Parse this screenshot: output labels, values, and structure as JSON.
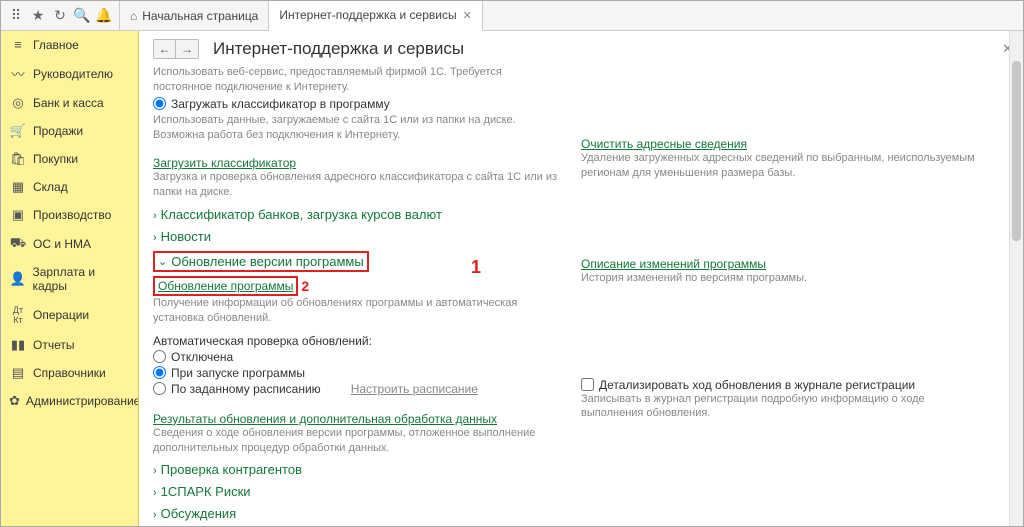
{
  "topbar": {
    "home_tab": "Начальная страница",
    "active_tab": "Интернет-поддержка и сервисы"
  },
  "sidebar": {
    "items": [
      {
        "label": "Главное",
        "icon": "≡"
      },
      {
        "label": "Руководителю",
        "icon": "📈"
      },
      {
        "label": "Банк и касса",
        "icon": "💰"
      },
      {
        "label": "Продажи",
        "icon": "🛒"
      },
      {
        "label": "Покупки",
        "icon": "🛍"
      },
      {
        "label": "Склад",
        "icon": "📦"
      },
      {
        "label": "Производство",
        "icon": "🏭"
      },
      {
        "label": "ОС и НМА",
        "icon": "🚚"
      },
      {
        "label": "Зарплата и кадры",
        "icon": "👤"
      },
      {
        "label": "Операции",
        "icon": "Дт"
      },
      {
        "label": "Отчеты",
        "icon": "📊"
      },
      {
        "label": "Справочники",
        "icon": "📓"
      },
      {
        "label": "Администрирование",
        "icon": "⚙"
      }
    ]
  },
  "page": {
    "title": "Интернет-поддержка и сервисы",
    "intro1": "Использовать веб-сервис, предоставляемый фирмой 1С. Требуется постоянное подключение к Интернету.",
    "radio_load": "Загружать классификатор в программу",
    "intro2": "Использовать данные, загружаемые с сайта 1С или из папки на диске. Возможна работа без подключения к Интернету.",
    "load_classifier": "Загрузить классификатор",
    "load_classifier_desc": "Загрузка и проверка обновления адресного классификатора с сайта 1С или из папки на диске.",
    "clear_addr": "Очистить адресные сведения",
    "clear_addr_desc": "Удаление загруженных адресных сведений по выбранным, неиспользуемым регионам для уменьшения размера базы.",
    "exp_banks": "Классификатор банков, загрузка курсов валют",
    "exp_news": "Новости",
    "section_update": "Обновление версии программы",
    "update_program": "Обновление программы",
    "update_program_desc": "Получение информации об обновлениях программы и автоматическая установка обновлений.",
    "changes_desc_link": "Описание изменений программы",
    "changes_desc_text": "История изменений по версиям программы.",
    "auto_check_label": "Автоматическая проверка обновлений:",
    "opt_off": "Отключена",
    "opt_on_start": "При запуске программы",
    "opt_schedule": "По заданному расписанию",
    "configure_schedule": "Настроить расписание",
    "results_link": "Результаты обновления и дополнительная обработка данных",
    "results_desc": "Сведения о ходе обновления версии программы, отложенное выполнение дополнительных процедур обработки данных.",
    "detail_checkbox": "Детализировать ход обновления в журнале регистрации",
    "detail_desc": "Записывать в журнал регистрации подробную информацию о ходе выполнения обновления.",
    "exp_check_contr": "Проверка контрагентов",
    "exp_spark": "1СПАРК Риски",
    "exp_discuss": "Обсуждения",
    "marker1": "1",
    "marker2": "2"
  }
}
